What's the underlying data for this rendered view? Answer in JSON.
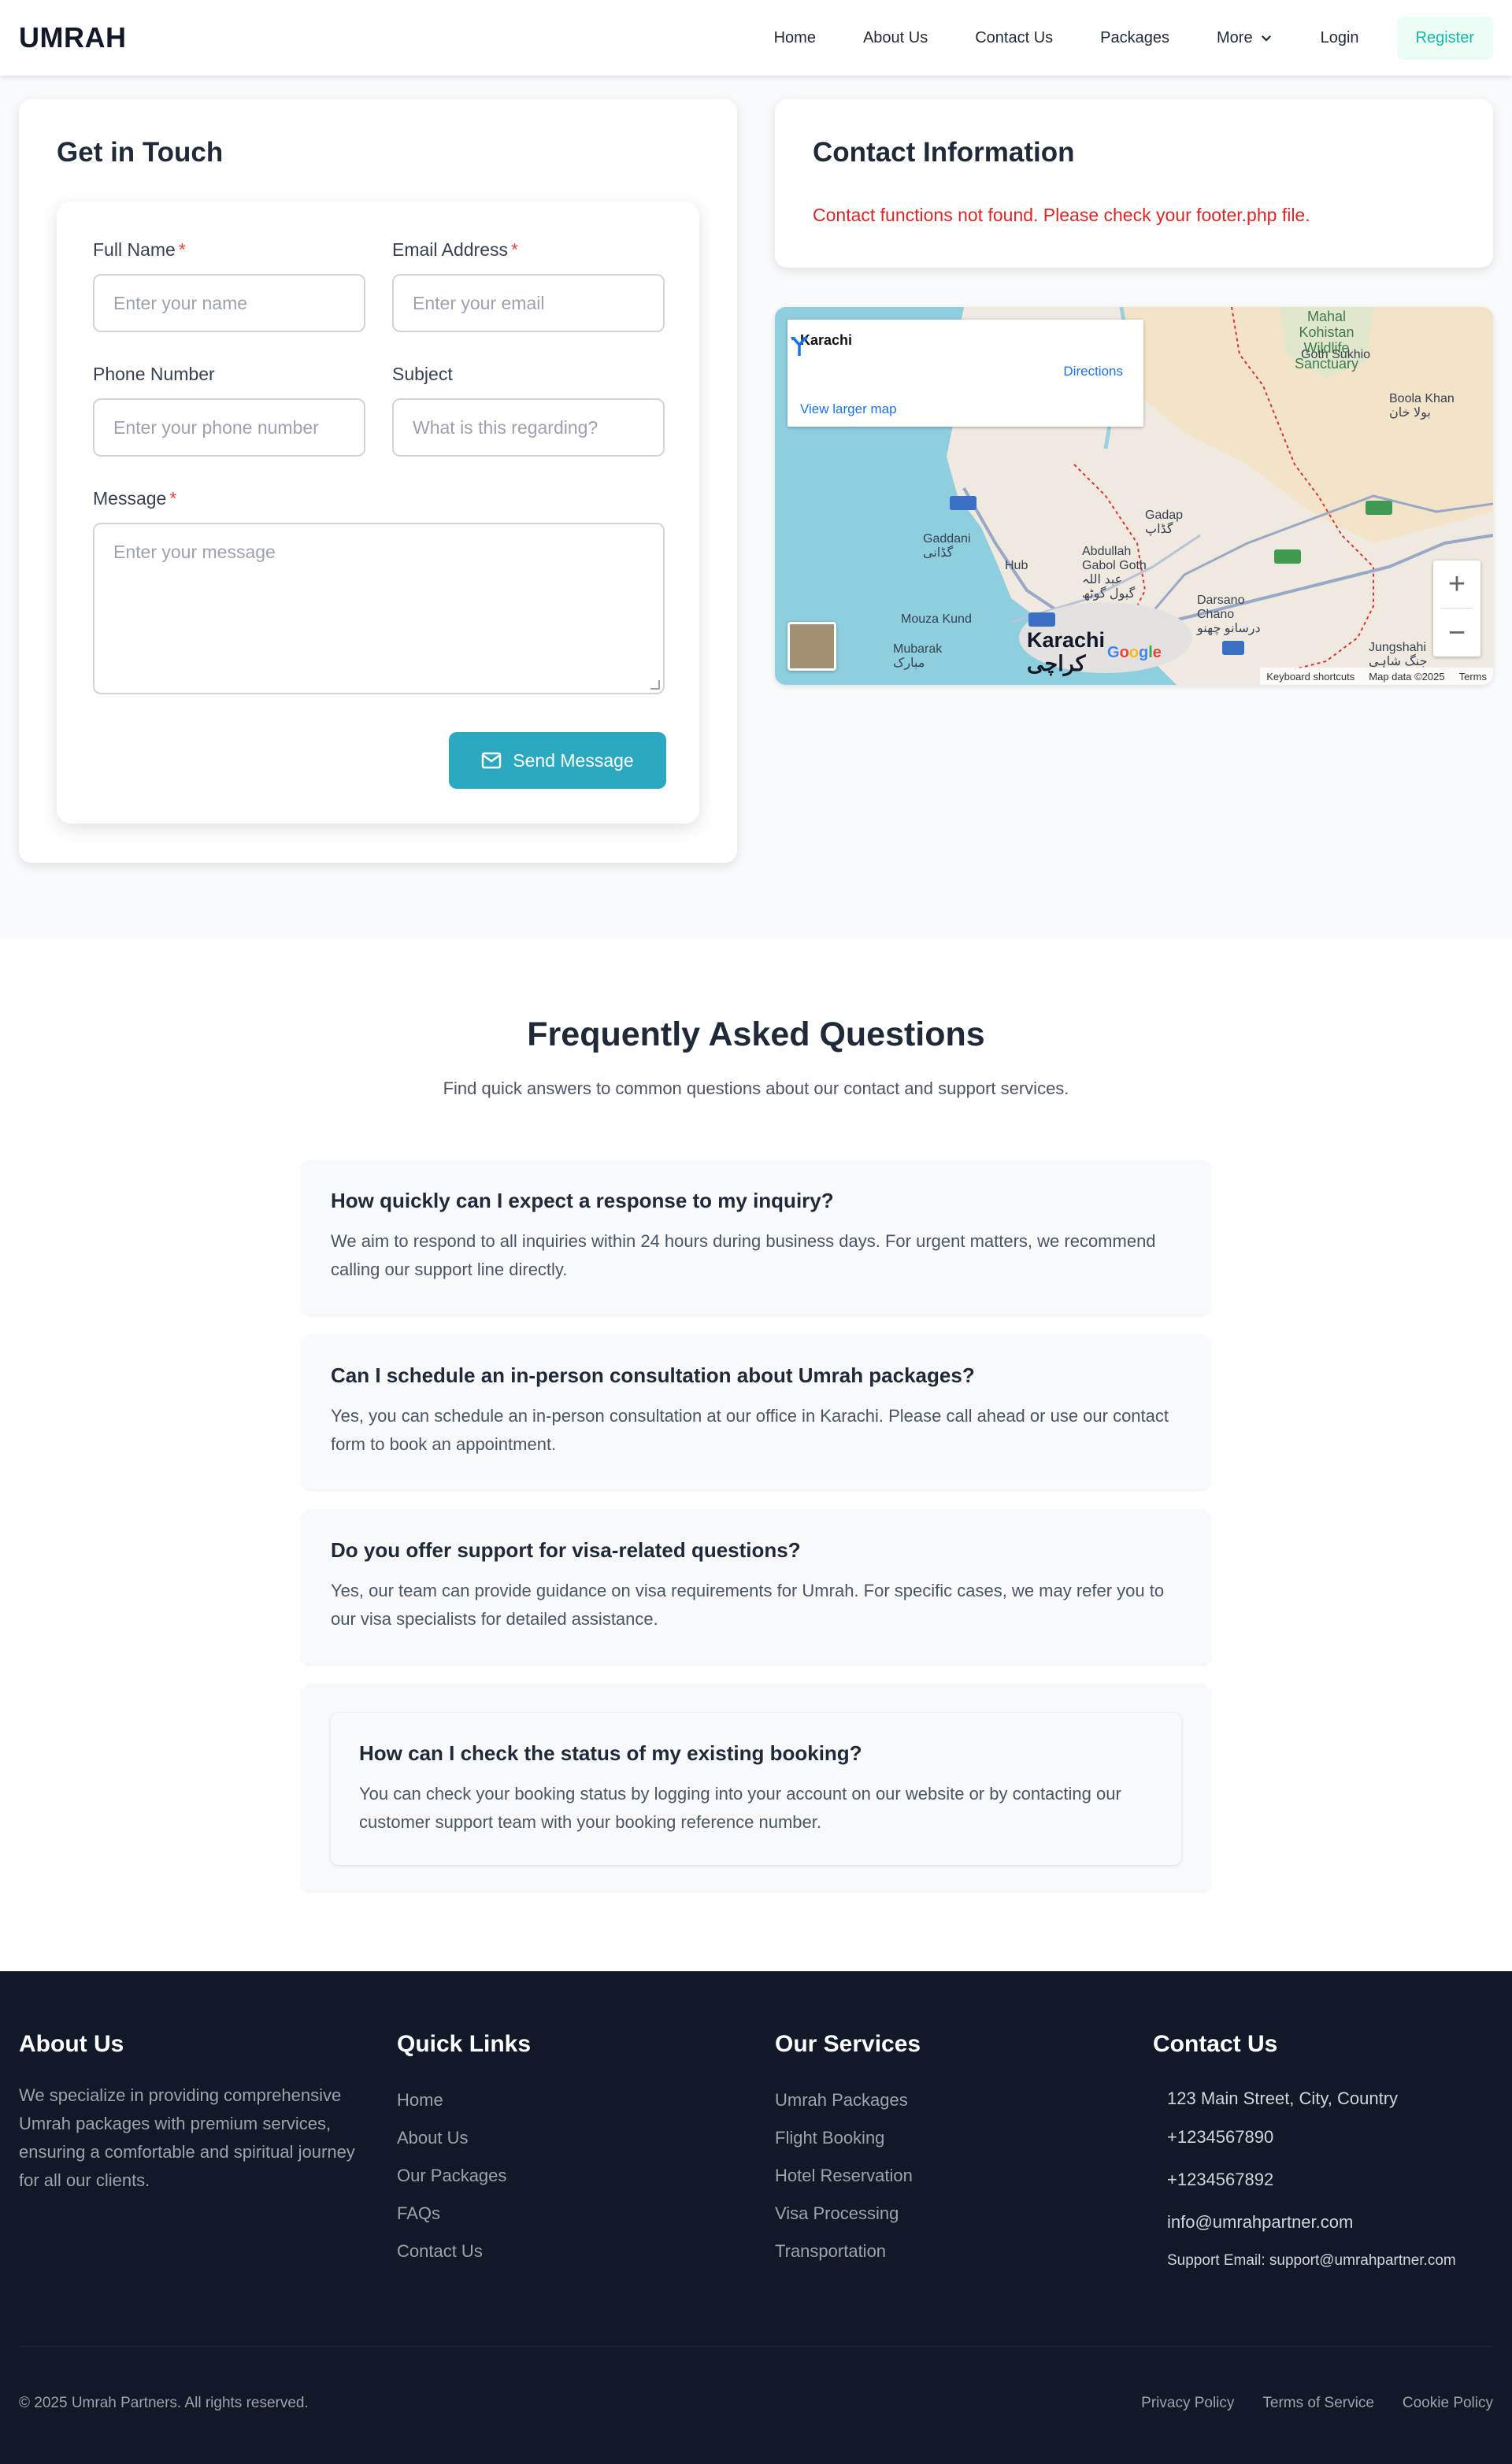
{
  "nav": {
    "brand": "UMRAH",
    "links": [
      "Home",
      "About Us",
      "Contact Us",
      "Packages",
      "More",
      "Login"
    ],
    "register": "Register"
  },
  "form": {
    "title": "Get in Touch",
    "full_name": {
      "label": "Full Name",
      "placeholder": "Enter your name",
      "required": "*"
    },
    "email": {
      "label": "Email Address",
      "placeholder": "Enter your email",
      "required": "*"
    },
    "phone": {
      "label": "Phone Number",
      "placeholder": "Enter your phone number"
    },
    "subject": {
      "label": "Subject",
      "placeholder": "What is this regarding?"
    },
    "message": {
      "label": "Message",
      "placeholder": "Enter your message",
      "required": "*"
    },
    "send": "Send Message"
  },
  "contact_info": {
    "title": "Contact Information",
    "error": "Contact functions not found. Please check your footer.php file."
  },
  "map": {
    "place": "Karachi",
    "directions": "Directions",
    "larger": "View larger map",
    "labels": {
      "mahal": "Mahal\nKohistan\nWildlife\nSanctuary",
      "goth": "Goth Sukhio",
      "boola": "Boola Khan\nبولا خان",
      "gadap": "Gadap\nگڈاپ",
      "gaddani": "Gaddani\nگڈانی",
      "hub": "Hub",
      "abdullah": "Abdullah\nGabol Goth\nعبد اللہ\nگبول گوٹھ",
      "darsano": "Darsano\nChano\nدرسانو چھنو",
      "mouza": "Mouza Kund",
      "mubarak": "Mubarak\nمبارک",
      "karachi": "Karachi\nکراچی",
      "jungshahi": "Jungshahi\nجنگ شاہی"
    },
    "zoom_in": "+",
    "zoom_out": "−",
    "keyboard": "Keyboard shortcuts",
    "map_data": "Map data ©2025",
    "terms": "Terms",
    "google": "Google"
  },
  "faq": {
    "title": "Frequently Asked Questions",
    "subtitle": "Find quick answers to common questions about our contact and support services.",
    "items": [
      {
        "q": "How quickly can I expect a response to my inquiry?",
        "a": "We aim to respond to all inquiries within 24 hours during business days. For urgent matters, we recommend calling our support line directly."
      },
      {
        "q": "Can I schedule an in-person consultation about Umrah packages?",
        "a": "Yes, you can schedule an in-person consultation at our office in Karachi. Please call ahead or use our contact form to book an appointment."
      },
      {
        "q": "Do you offer support for visa-related questions?",
        "a": "Yes, our team can provide guidance on visa requirements for Umrah. For specific cases, we may refer you to our visa specialists for detailed assistance."
      },
      {
        "q": "How can I check the status of my existing booking?",
        "a": "You can check your booking status by logging into your account on our website or by contacting our customer support team with your booking reference number."
      }
    ]
  },
  "footer": {
    "about": {
      "title": "About Us",
      "text": "We specialize in providing comprehensive Umrah packages with premium services, ensuring a comfortable and spiritual journey for all our clients."
    },
    "quick": {
      "title": "Quick Links",
      "links": [
        "Home",
        "About Us",
        "Our Packages",
        "FAQs",
        "Contact Us"
      ]
    },
    "services": {
      "title": "Our Services",
      "links": [
        "Umrah Packages",
        "Flight Booking",
        "Hotel Reservation",
        "Visa Processing",
        "Transportation"
      ]
    },
    "contact": {
      "title": "Contact Us",
      "address": "123 Main Street, City, Country",
      "phone1": "+1234567890",
      "phone2": "+1234567892",
      "email": "info@umrahpartner.com",
      "support": "Support Email: support@umrahpartner.com"
    },
    "copyright": "© 2025 Umrah Partners. All rights reserved.",
    "legal": [
      "Privacy Policy",
      "Terms of Service",
      "Cookie Policy"
    ]
  }
}
